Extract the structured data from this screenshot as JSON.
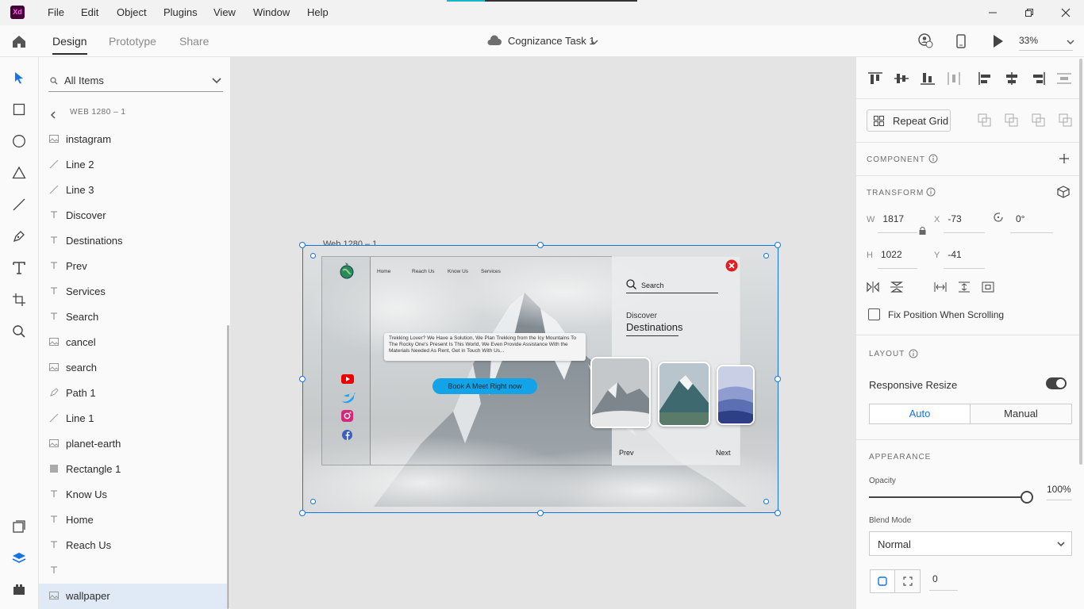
{
  "app": {
    "logo_text": "Xd",
    "menu": [
      "File",
      "Edit",
      "Object",
      "Plugins",
      "View",
      "Window",
      "Help"
    ],
    "upload_progress": 0.2
  },
  "nav": {
    "tabs": [
      "Design",
      "Prototype",
      "Share"
    ],
    "doc_title": "Cognizance Task 1",
    "zoom": "33%"
  },
  "layers": {
    "search_label": "All Items",
    "breadcrumb": "WEB 1280 – 1",
    "items": [
      {
        "name": "instagram",
        "kind": "image"
      },
      {
        "name": "Line 2",
        "kind": "line"
      },
      {
        "name": "Line 3",
        "kind": "line"
      },
      {
        "name": "Discover",
        "kind": "text"
      },
      {
        "name": "Destinations",
        "kind": "text"
      },
      {
        "name": "Prev",
        "kind": "text"
      },
      {
        "name": "Services",
        "kind": "text"
      },
      {
        "name": "Search",
        "kind": "text"
      },
      {
        "name": "cancel",
        "kind": "image"
      },
      {
        "name": "search",
        "kind": "image"
      },
      {
        "name": "Path 1",
        "kind": "path"
      },
      {
        "name": "Line 1",
        "kind": "line"
      },
      {
        "name": "planet-earth",
        "kind": "image"
      },
      {
        "name": "Rectangle 1",
        "kind": "rect"
      },
      {
        "name": "Know Us",
        "kind": "text"
      },
      {
        "name": "Home",
        "kind": "text"
      },
      {
        "name": "Reach Us",
        "kind": "text"
      },
      {
        "name": "",
        "kind": "text"
      },
      {
        "name": "wallpaper",
        "kind": "image",
        "selected": true
      }
    ]
  },
  "artboard": {
    "label": "Web 1280 – 1",
    "nav": [
      "Home",
      "Reach Us",
      "Know Us",
      "Services"
    ],
    "description": "Trekking Lover? We Have a Solution, We Plan Trekking from the Icy Mountains To The Rocky One's Present Is This World, We Even Provide Assistance With the Materials Needed As Rent, Get in Touch With Us...",
    "cta": "Book A Meet Right now",
    "search": "Search",
    "discover": "Discover",
    "destinations": "Destinations",
    "prev": "Prev",
    "next": "Next"
  },
  "properties": {
    "repeat_grid": "Repeat Grid",
    "component_title": "COMPONENT",
    "transform_title": "TRANSFORM",
    "w_label": "W",
    "w": "1817",
    "h_label": "H",
    "h": "1022",
    "x_label": "X",
    "x": "-73",
    "y_label": "Y",
    "y": "-41",
    "rotation": "0°",
    "fix_position": "Fix Position When Scrolling",
    "layout_title": "LAYOUT",
    "responsive_resize": "Responsive Resize",
    "auto": "Auto",
    "manual": "Manual",
    "appearance_title": "APPEARANCE",
    "opacity_label": "Opacity",
    "opacity": "100%",
    "opacity_value": 1.0,
    "blend_label": "Blend Mode",
    "blend": "Normal",
    "corner_radius": "0"
  },
  "colors": {
    "accent": "#1473e6",
    "brand": "#470137",
    "cta": "#12a4e6"
  }
}
